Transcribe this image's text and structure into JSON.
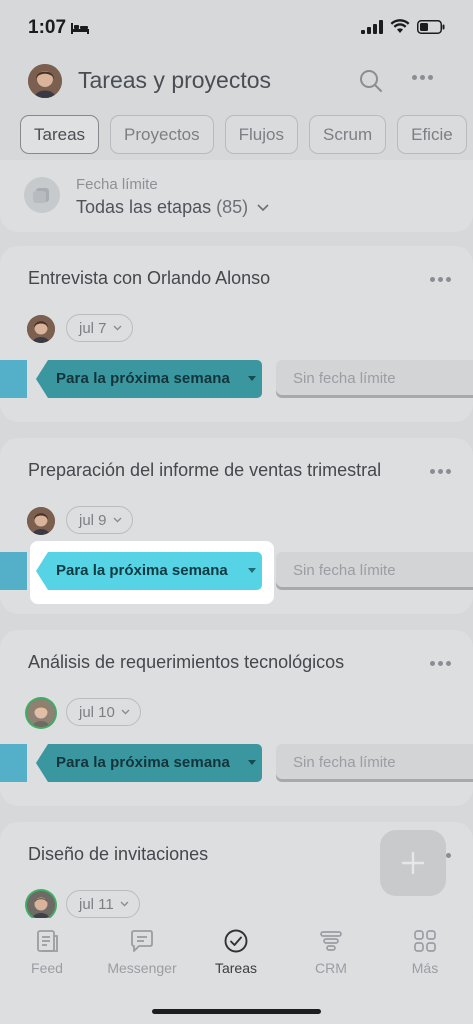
{
  "status": {
    "time": "1:07"
  },
  "header": {
    "title": "Tareas y proyectos"
  },
  "tabs": [
    {
      "label": "Tareas",
      "active": true
    },
    {
      "label": "Proyectos"
    },
    {
      "label": "Flujos"
    },
    {
      "label": "Scrum"
    },
    {
      "label": "Eficie"
    }
  ],
  "filter": {
    "label": "Fecha límite",
    "value": "Todas las etapas",
    "count": "(85)"
  },
  "tasks": [
    {
      "title": "Entrevista con Orlando Alonso",
      "date": "jul 7",
      "stage": "Para la próxima semana",
      "deadline": "Sin fecha límite"
    },
    {
      "title": "Preparación del informe de ventas trimestral",
      "date": "jul 9",
      "stage": "Para la próxima semana",
      "deadline": "Sin fecha límite"
    },
    {
      "title": "Análisis de requerimientos tecnológicos",
      "date": "jul 10",
      "stage": "Para la próxima semana",
      "deadline": "Sin fecha límite"
    },
    {
      "title": "Diseño de invitaciones",
      "date": "jul 11"
    }
  ],
  "nav": [
    {
      "label": "Feed"
    },
    {
      "label": "Messenger"
    },
    {
      "label": "Tareas",
      "active": true
    },
    {
      "label": "CRM"
    },
    {
      "label": "Más"
    }
  ],
  "colors": {
    "stage": "#3a97a0",
    "stage_highlight": "#56d3e4",
    "stage_left_bar": "#2ea1c1",
    "overlay_bg": "#d6d8da"
  }
}
